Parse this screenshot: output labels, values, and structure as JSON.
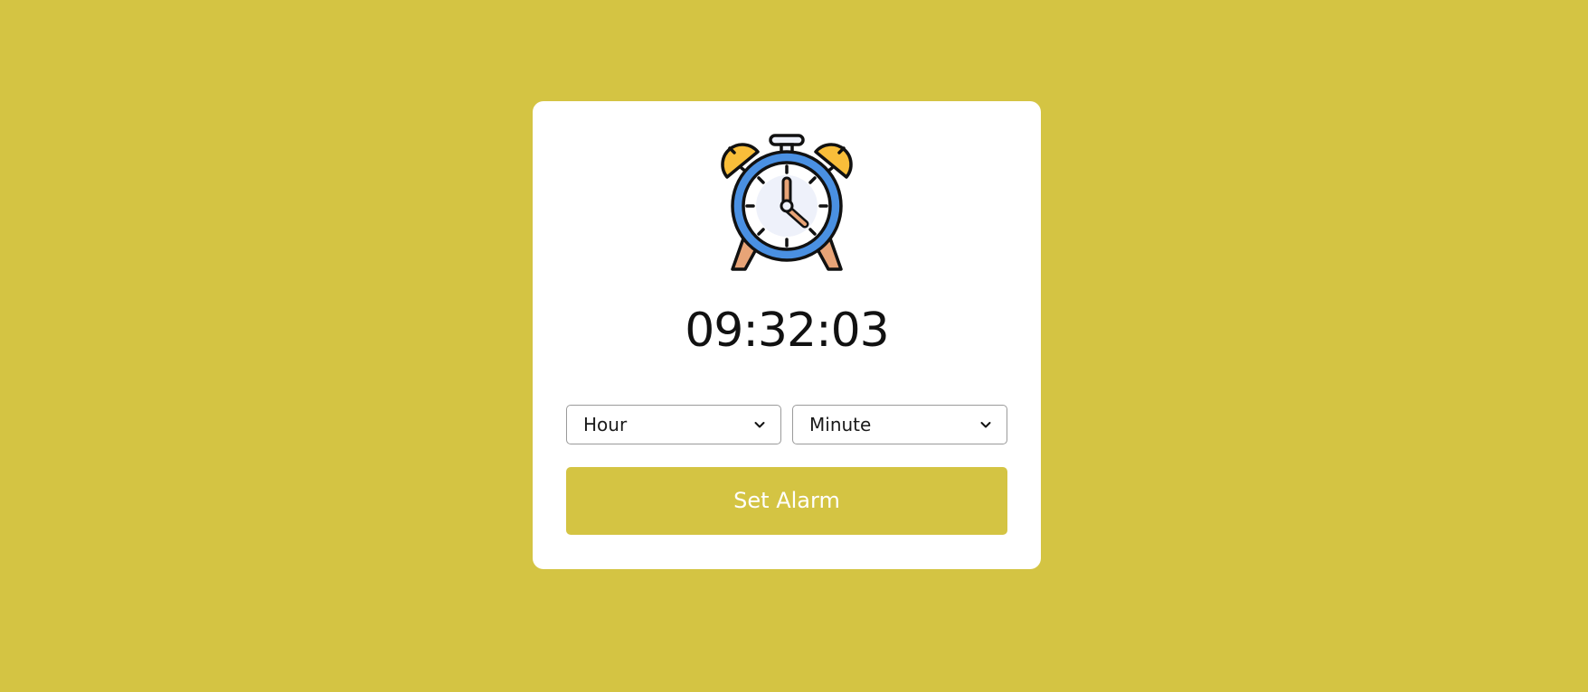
{
  "page": {
    "background_color": "#D4C443"
  },
  "card": {
    "background_color": "#FFFFFF",
    "icon": "alarm-clock-icon"
  },
  "clock": {
    "time": "09:32:03"
  },
  "selects": {
    "hour": {
      "selected": "Hour",
      "icon": "chevron-down-icon"
    },
    "minute": {
      "selected": "Minute",
      "icon": "chevron-down-icon"
    }
  },
  "button": {
    "label": "Set Alarm",
    "background_color": "#D4C443",
    "text_color": "#FFFFFF"
  },
  "icon_colors": {
    "bell": "#F9BE3A",
    "ring": "#4A90E2",
    "face": "#EEF1FA",
    "hands": "#E8A477",
    "outline": "#111111"
  }
}
